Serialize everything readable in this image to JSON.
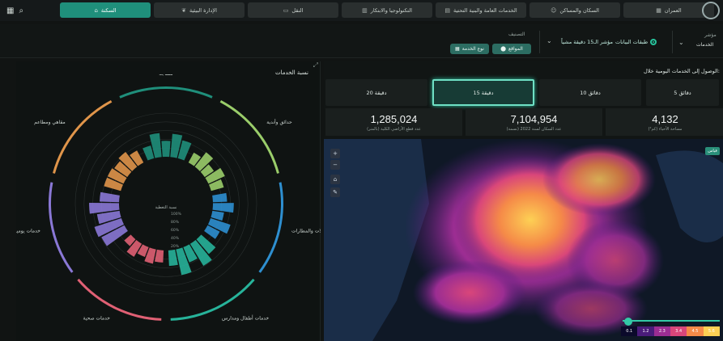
{
  "topbar": {
    "tabs": [
      {
        "label": "السكنة",
        "icon": "home-icon",
        "active": true
      },
      {
        "label": "الإدارة البيئية",
        "icon": "leaf-icon",
        "active": false
      },
      {
        "label": "النقل",
        "icon": "bus-icon",
        "active": false
      },
      {
        "label": "التكنولوجيا والابتكار",
        "icon": "chart-icon",
        "active": false
      },
      {
        "label": "الخدمات العامة والبنية التحتية",
        "icon": "building-icon",
        "active": false
      },
      {
        "label": "السكان والمساكن",
        "icon": "people-icon",
        "active": false
      },
      {
        "label": "العمران",
        "icon": "city-icon",
        "active": false
      }
    ]
  },
  "filters": {
    "category_label": "التصنيف",
    "chip_sites": "المواقع",
    "chip_service_type": "نوع الخدمة",
    "radio_selected": "مؤشر الـ15 دقيقة مشياً",
    "radio_other": "طبقات البيانات",
    "right_label": "مؤشر",
    "right_value": "الخدمات"
  },
  "left_panel": {
    "title": "نسبة الخدمات",
    "categories": [
      {
        "label": "مساجد",
        "color": "#1f8f7b"
      },
      {
        "label": "حدائق وأندية",
        "color": "#9acd6a"
      },
      {
        "label": "محطات حافلات والمطارات",
        "color": "#2e8fd0"
      },
      {
        "label": "خدمات أطفال ومدارس",
        "color": "#27b39a"
      },
      {
        "label": "خدمات صحية",
        "color": "#e06074"
      },
      {
        "label": "خدمات يومية",
        "color": "#8a78d6"
      },
      {
        "label": "مقاهي ومطاعم",
        "color": "#e0954a"
      }
    ],
    "axis_ticks": [
      "100%",
      "80%",
      "60%",
      "40%",
      "20%"
    ],
    "inner_label": "نسبة التغطية"
  },
  "right_panel": {
    "heading": "الوصول إلى الخدمات اليومية خلال:",
    "time_options": [
      "20 دقيقة",
      "15 دقيقة",
      "10 دقائق",
      "5 دقائق"
    ],
    "active_time": "15 دقيقة",
    "stats": [
      {
        "value": "1,285,024",
        "label": "عدد قطع الأراضي الكلية (بالمتر)"
      },
      {
        "value": "7,104,954",
        "label": "عدد السكان لسنة 2022 (نسمة)"
      },
      {
        "value": "4,132",
        "label": "مساحة الأحياء (كم²)"
      }
    ],
    "legend": [
      "0.1",
      "1.2",
      "2.3",
      "3.4",
      "4.5",
      "5.6"
    ],
    "legend_colors": [
      "#0b0a2b",
      "#4a1c7a",
      "#9b2d92",
      "#d9467a",
      "#f58a48",
      "#fdd054"
    ],
    "map_badge": "قياس",
    "map_tools": [
      "+",
      "−",
      "⌂",
      "✎"
    ]
  },
  "chart_data": {
    "type": "bar",
    "categories": [
      "مساجد",
      "حدائق وأندية",
      "محطات حافلات والمطارات",
      "خدمات أطفال ومدارس",
      "خدمات صحية",
      "خدمات يومية",
      "مقاهي ومطاعم"
    ],
    "series": [
      {
        "values": [
          55,
          42,
          48,
          60,
          35,
          70,
          45
        ]
      }
    ],
    "ylim": [
      0,
      100
    ]
  }
}
